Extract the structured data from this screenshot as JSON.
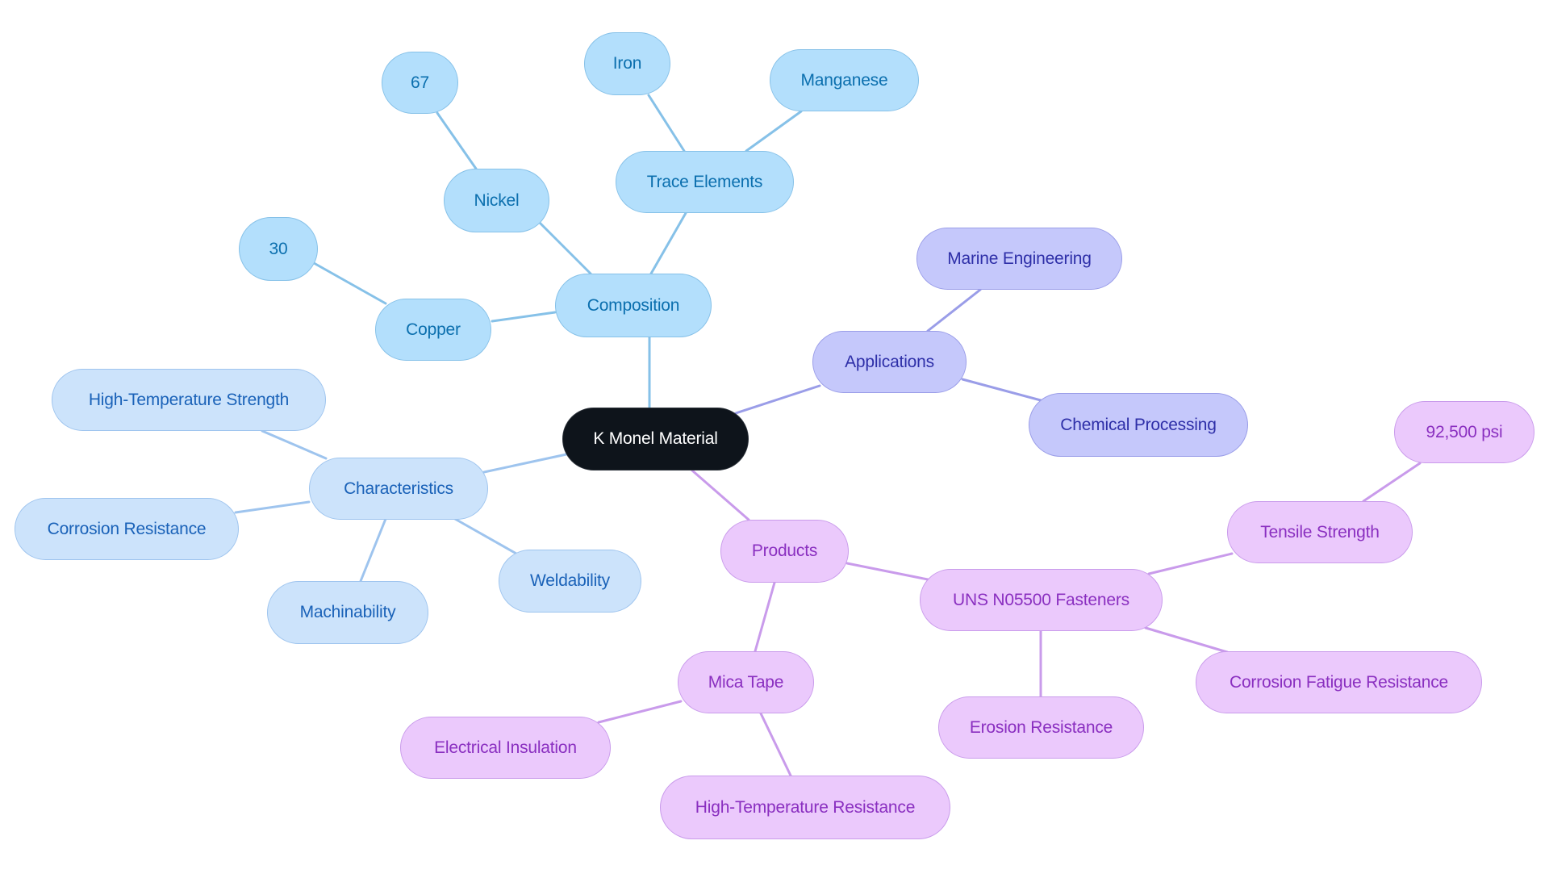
{
  "title": "K Monel Material",
  "colors": {
    "root": "#0e141b",
    "composition": "#86c1e8",
    "characteristics": "#9ec4ee",
    "applications": "#9a9de8",
    "products": "#c99beb"
  },
  "mindmap": {
    "root": "K Monel Material",
    "branches": [
      {
        "label": "Composition",
        "children": [
          {
            "label": "Copper",
            "children": [
              {
                "label": "30"
              }
            ]
          },
          {
            "label": "Nickel",
            "children": [
              {
                "label": "67"
              }
            ]
          },
          {
            "label": "Trace Elements",
            "children": [
              {
                "label": "Iron"
              },
              {
                "label": "Manganese"
              }
            ]
          }
        ]
      },
      {
        "label": "Applications",
        "children": [
          {
            "label": "Marine Engineering"
          },
          {
            "label": "Chemical Processing"
          }
        ]
      },
      {
        "label": "Characteristics",
        "children": [
          {
            "label": "High-Temperature Strength"
          },
          {
            "label": "Corrosion Resistance"
          },
          {
            "label": "Machinability"
          },
          {
            "label": "Weldability"
          }
        ]
      },
      {
        "label": "Products",
        "children": [
          {
            "label": "UNS N05500 Fasteners",
            "children": [
              {
                "label": "Tensile Strength",
                "children": [
                  {
                    "label": "92,500 psi"
                  }
                ]
              },
              {
                "label": "Corrosion Fatigue Resistance"
              },
              {
                "label": "Erosion Resistance"
              }
            ]
          },
          {
            "label": "Mica Tape",
            "children": [
              {
                "label": "Electrical Insulation"
              },
              {
                "label": "High-Temperature Resistance"
              }
            ]
          }
        ]
      }
    ]
  }
}
